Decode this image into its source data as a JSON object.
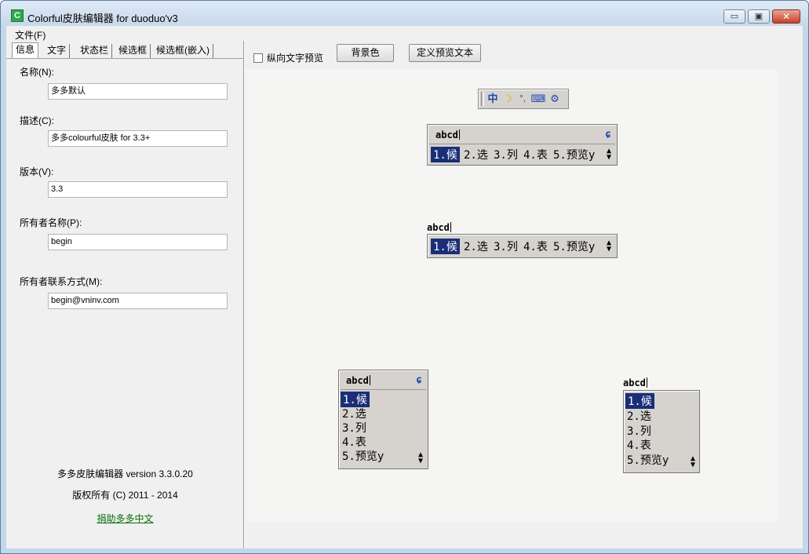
{
  "window": {
    "title": "Colorful皮肤编辑器 for duoduo'v3",
    "app_icon_glyph": "C",
    "min_glyph": "▭",
    "max_glyph": "▣",
    "close_glyph": "✕"
  },
  "menu": {
    "file": "文件(F)"
  },
  "tabs": [
    "信息",
    "文字",
    "状态栏",
    "候选框",
    "候选框(嵌入)"
  ],
  "fields": {
    "name": {
      "label": "名称(N):",
      "value": "多多默认"
    },
    "desc": {
      "label": "描述(C):",
      "value": "多多colourful皮肤 for 3.3+"
    },
    "version": {
      "label": "版本(V):",
      "value": "3.3"
    },
    "owner": {
      "label": "所有者名称(P):",
      "value": "begin"
    },
    "contact": {
      "label": "所有者联系方式(M):",
      "value": "begin@vninv.com"
    }
  },
  "footer": {
    "app_version": "多多皮肤编辑器 version 3.3.0.20",
    "copyright": "版权所有 (C) 2011 - 2014",
    "donate": "捐助多多中文"
  },
  "toolbar": {
    "vertical_preview": "纵向文字预览",
    "vertical_checked": false,
    "bg_color": "背景色",
    "custom_text": "定义预览文本"
  },
  "preview": {
    "composition": "abcd",
    "candidates": [
      "1.候",
      "2.选",
      "3.列",
      "4.表",
      "5.预览y"
    ],
    "statusbar_icons": [
      "ime-bar-handle-icon",
      "chinese-mode-icon",
      "halfwidth-moon-icon",
      "punctuation-icon",
      "soft-keyboard-icon",
      "settings-gear-icon"
    ],
    "selected_color": "#1a2e78",
    "panel_color": "#d6d3ce"
  }
}
